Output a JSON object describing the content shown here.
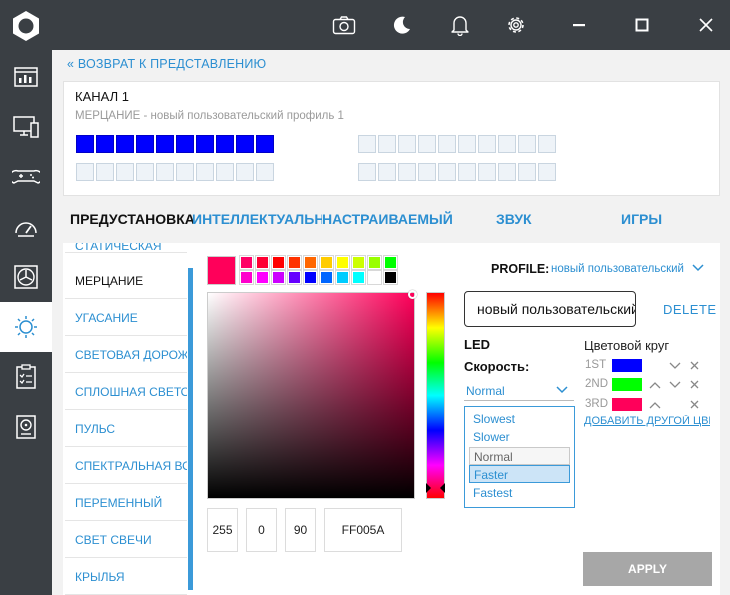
{
  "back_link": "ВОЗВРАТ К ПРЕДСТАВЛЕНИЮ",
  "channel": {
    "title": "КАНАЛ 1",
    "subtitle": "МЕРЦАНИЕ - новый пользовательский профиль 1",
    "leds_on_count": 10
  },
  "tabs": [
    {
      "label": "ПРЕДУСТАНОВКА"
    },
    {
      "label": "ИНТЕЛЛЕКТУАЛЬНЫ"
    },
    {
      "label": "НАСТРАИВАЕМЫЙ"
    },
    {
      "label": "ЗВУК"
    },
    {
      "label": "ИГРЫ"
    }
  ],
  "effects": [
    {
      "label": "СТАТИЧЕСКАЯ"
    },
    {
      "label": "МЕРЦАНИЕ"
    },
    {
      "label": "УГАСАНИЕ"
    },
    {
      "label": "СВЕТОВАЯ ДОРОЖКА"
    },
    {
      "label": "СПЛОШНАЯ СВЕТОВАЯ"
    },
    {
      "label": "ПУЛЬС"
    },
    {
      "label": "СПЕКТРАЛЬНАЯ ВОЛНА"
    },
    {
      "label": "ПЕРЕМЕННЫЙ"
    },
    {
      "label": "СВЕТ СВЕЧИ"
    },
    {
      "label": "КРЫЛЬЯ"
    }
  ],
  "picker": {
    "current_color": "#ff005a",
    "swatches": [
      [
        "#ff0066",
        "#ff0033",
        "#ff0000",
        "#ff3300",
        "#ff6600",
        "#ffcc00",
        "#ffff00",
        "#ccff00",
        "#99ff00",
        "#00ff00"
      ],
      [
        "#ff00cc",
        "#ff00ff",
        "#cc00ff",
        "#6600ff",
        "#0000ff",
        "#0066ff",
        "#00ccff",
        "#00ffff",
        "#ffffff",
        "#000000"
      ]
    ],
    "r": "255",
    "g": "0",
    "b": "90",
    "hex": "FF005A"
  },
  "profile": {
    "label": "PROFILE:",
    "value": "новый пользовательский профиль 1",
    "input_value": "новый пользовательский профиль 1",
    "delete": "DELETE"
  },
  "led_label": "LED",
  "speed": {
    "label": "Скорость:",
    "selected": "Normal",
    "options": [
      "Slowest",
      "Slower",
      "Normal",
      "Faster",
      "Fastest"
    ]
  },
  "color_wheel": {
    "title": "Цветовой круг",
    "entries": [
      {
        "label": "1ST",
        "color": "#0000ff"
      },
      {
        "label": "2ND",
        "color": "#00ff00"
      },
      {
        "label": "3RD",
        "color": "#ff005a"
      }
    ],
    "add_label": "ДОБАВИТЬ ДРУГОЙ ЦВЕТ"
  },
  "apply": "APPLY"
}
